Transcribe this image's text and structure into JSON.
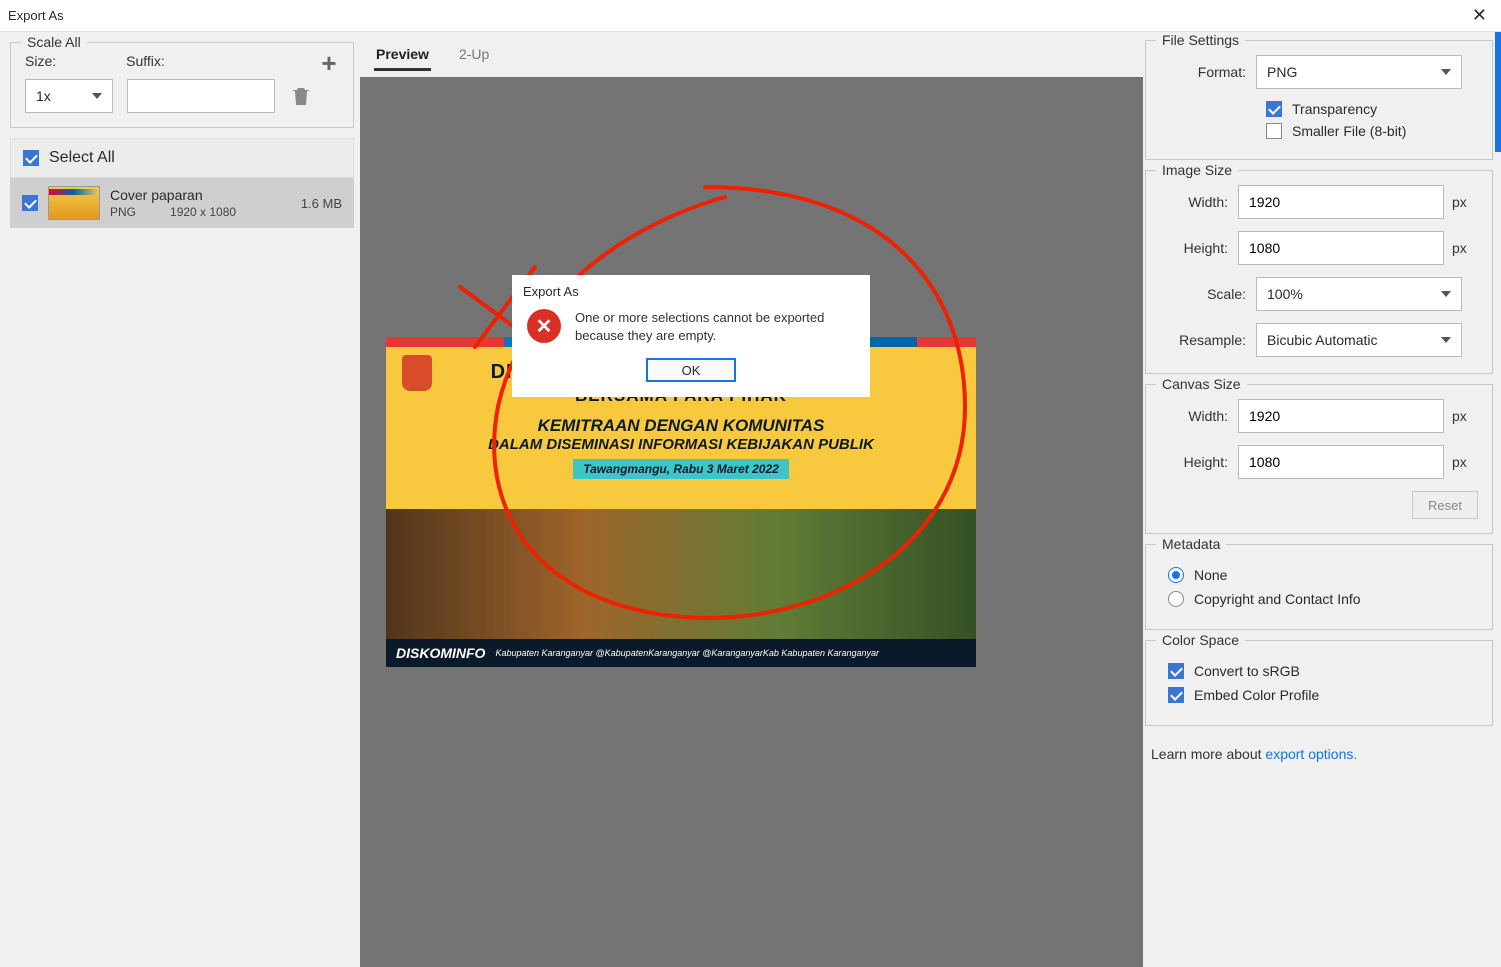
{
  "window": {
    "title": "Export As",
    "close_glyph": "✕"
  },
  "scale_all": {
    "legend": "Scale All",
    "size_label": "Size:",
    "suffix_label": "Suffix:",
    "size_value": "1x",
    "suffix_value": ""
  },
  "asset_list": {
    "select_all_label": "Select All",
    "items": [
      {
        "name": "Cover paparan",
        "format": "PNG",
        "dimensions": "1920 x 1080",
        "filesize": "1.6 MB"
      }
    ]
  },
  "tabs": {
    "preview": "Preview",
    "two_up": "2-Up"
  },
  "artwork_text": {
    "line1": "DISE",
    "line1_suffix": "IK",
    "line2": "BERSAMA PARA PIHAK",
    "line3": "KEMITRAAN DENGAN KOMUNITAS",
    "line4": "DALAM DISEMINASI INFORMASI KEBIJAKAN PUBLIK",
    "date": "Tawangmangu, Rabu 3 Maret 2022",
    "footer_brand": "DISKOMINFO",
    "footer_social": "Kabupaten Karanganyar   @KabupatenKaranganyar   @KaranganyarKab   Kabupaten Karanganyar"
  },
  "modal": {
    "title": "Export As",
    "message": "One or more selections cannot be exported because they are empty.",
    "ok_label": "OK"
  },
  "file_settings": {
    "legend": "File Settings",
    "format_label": "Format:",
    "format_value": "PNG",
    "transparency_label": "Transparency",
    "smaller_file_label": "Smaller File (8-bit)"
  },
  "image_size": {
    "legend": "Image Size",
    "width_label": "Width:",
    "width_value": "1920",
    "height_label": "Height:",
    "height_value": "1080",
    "scale_label": "Scale:",
    "scale_value": "100%",
    "resample_label": "Resample:",
    "resample_value": "Bicubic Automatic",
    "unit": "px"
  },
  "canvas_size": {
    "legend": "Canvas Size",
    "width_label": "Width:",
    "width_value": "1920",
    "height_label": "Height:",
    "height_value": "1080",
    "unit": "px",
    "reset_label": "Reset"
  },
  "metadata": {
    "legend": "Metadata",
    "none_label": "None",
    "copyright_label": "Copyright and Contact Info"
  },
  "color_space": {
    "legend": "Color Space",
    "srgb_label": "Convert to sRGB",
    "embed_label": "Embed Color Profile"
  },
  "learn_more": {
    "prefix": "Learn more about ",
    "link": "export options."
  }
}
